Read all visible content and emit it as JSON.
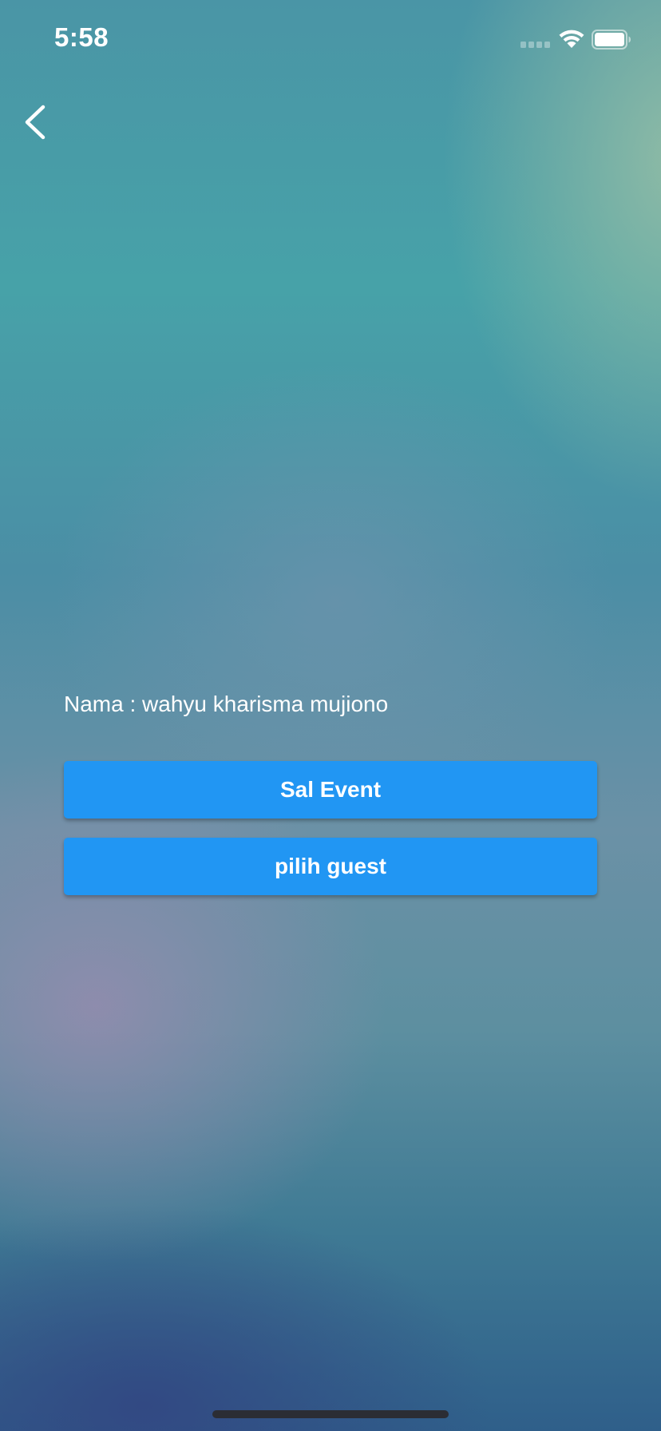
{
  "status_bar": {
    "time": "5:58",
    "icons": [
      "signal-icon",
      "wifi-icon",
      "battery-icon"
    ]
  },
  "nav": {
    "back_icon": "chevron-left-icon"
  },
  "profile": {
    "name_text": "Nama : wahyu kharisma mujiono"
  },
  "actions": {
    "event_label": "Sal Event",
    "guest_label": "pilih guest"
  },
  "colors": {
    "button": "#2196f3",
    "text": "#ffffff"
  }
}
